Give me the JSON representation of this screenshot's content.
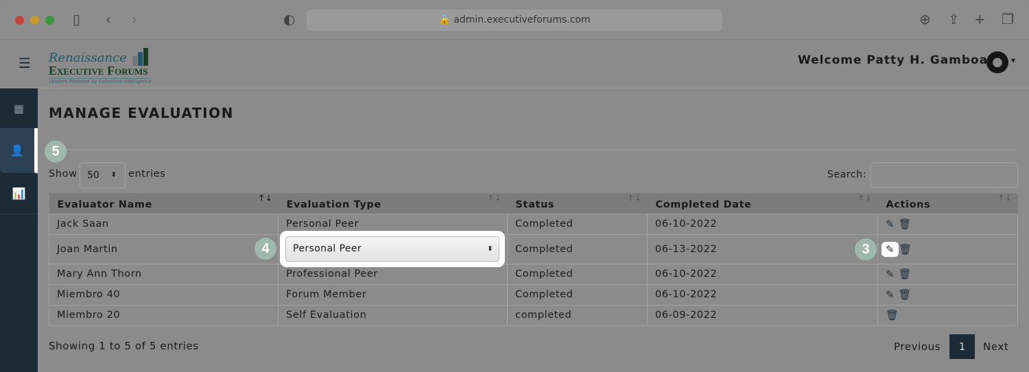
{
  "browser": {
    "url": "admin.executiveforums.com"
  },
  "header": {
    "logo_line1": "Renaissance",
    "logo_line2": "Executive Forums",
    "logo_tagline": "Leaders Powered by Collective Intelligence",
    "welcome": "Welcome Patty H. Gamboa"
  },
  "page": {
    "title": "MANAGE EVALUATION",
    "show_label": "Show",
    "entries_value": "50",
    "entries_label": "entries",
    "search_label": "Search:",
    "search_value": ""
  },
  "table": {
    "columns": [
      "Evaluator Name",
      "Evaluation Type",
      "Status",
      "Completed Date",
      "Actions"
    ],
    "rows": [
      {
        "name": "Jack Saan",
        "type": "Personal Peer",
        "status": "Completed",
        "date": "06-10-2022"
      },
      {
        "name": "Joan Martin",
        "type": "Personal Peer",
        "status": "Completed",
        "date": "06-13-2022"
      },
      {
        "name": "Mary Ann Thorn",
        "type": "Professional Peer",
        "status": "Completed",
        "date": "06-10-2022"
      },
      {
        "name": "Miembro 40",
        "type": "Forum Member",
        "status": "Completed",
        "date": "06-10-2022"
      },
      {
        "name": "Miembro 20",
        "type": "Self Evaluation",
        "status": "completed",
        "date": "06-09-2022"
      }
    ]
  },
  "footer": {
    "info": "Showing 1 to 5 of 5 entries",
    "previous": "Previous",
    "page": "1",
    "next": "Next"
  },
  "badges": {
    "b3": "3",
    "b4": "4",
    "b5": "5"
  },
  "colors": {
    "sidebar": "#1d2b37",
    "badge": "#9fb8ae",
    "overlay": "#8b8b8b"
  }
}
